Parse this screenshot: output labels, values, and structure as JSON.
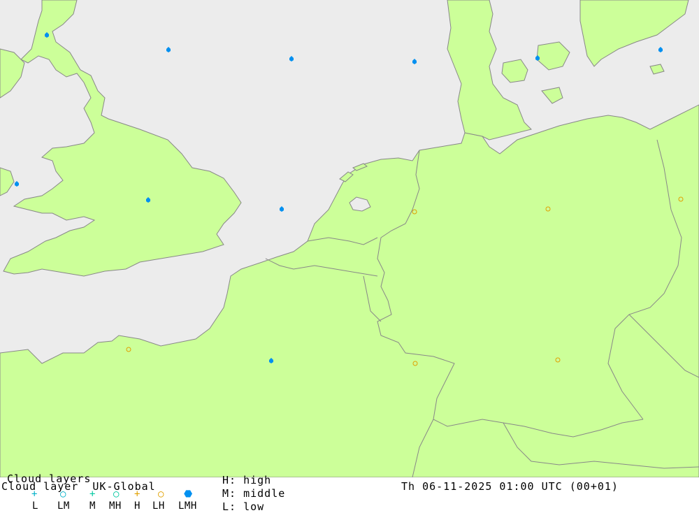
{
  "header": {
    "title": "Cloud layers",
    "subtitle": "Cloud layer  UK-Global",
    "datetime": "Th 06-11-2025 01:00 UTC (00+01)"
  },
  "key": {
    "high": "H: high",
    "middle": "M: middle",
    "low": "L: low"
  },
  "legend": [
    {
      "label": "L",
      "symbol": "+",
      "color": "#00b0c8"
    },
    {
      "label": "LM",
      "symbol": "○",
      "color": "#00b0c8"
    },
    {
      "label": "M",
      "symbol": "+",
      "color": "#00c8a0"
    },
    {
      "label": "MH",
      "symbol": "○",
      "color": "#00c8a0"
    },
    {
      "label": "H",
      "symbol": "+",
      "color": "#e0a000"
    },
    {
      "label": "LH",
      "symbol": "○",
      "color": "#e0a000"
    },
    {
      "label": "LMH",
      "symbol": "⬣",
      "color": "#0090f0"
    }
  ],
  "colors": {
    "sea": "#ececec",
    "land": "#ccff99",
    "border": "#888888"
  },
  "stations_lmh_icon": "filled-hexagon-blue",
  "stations_lh_icon": "open-circle-orange"
}
